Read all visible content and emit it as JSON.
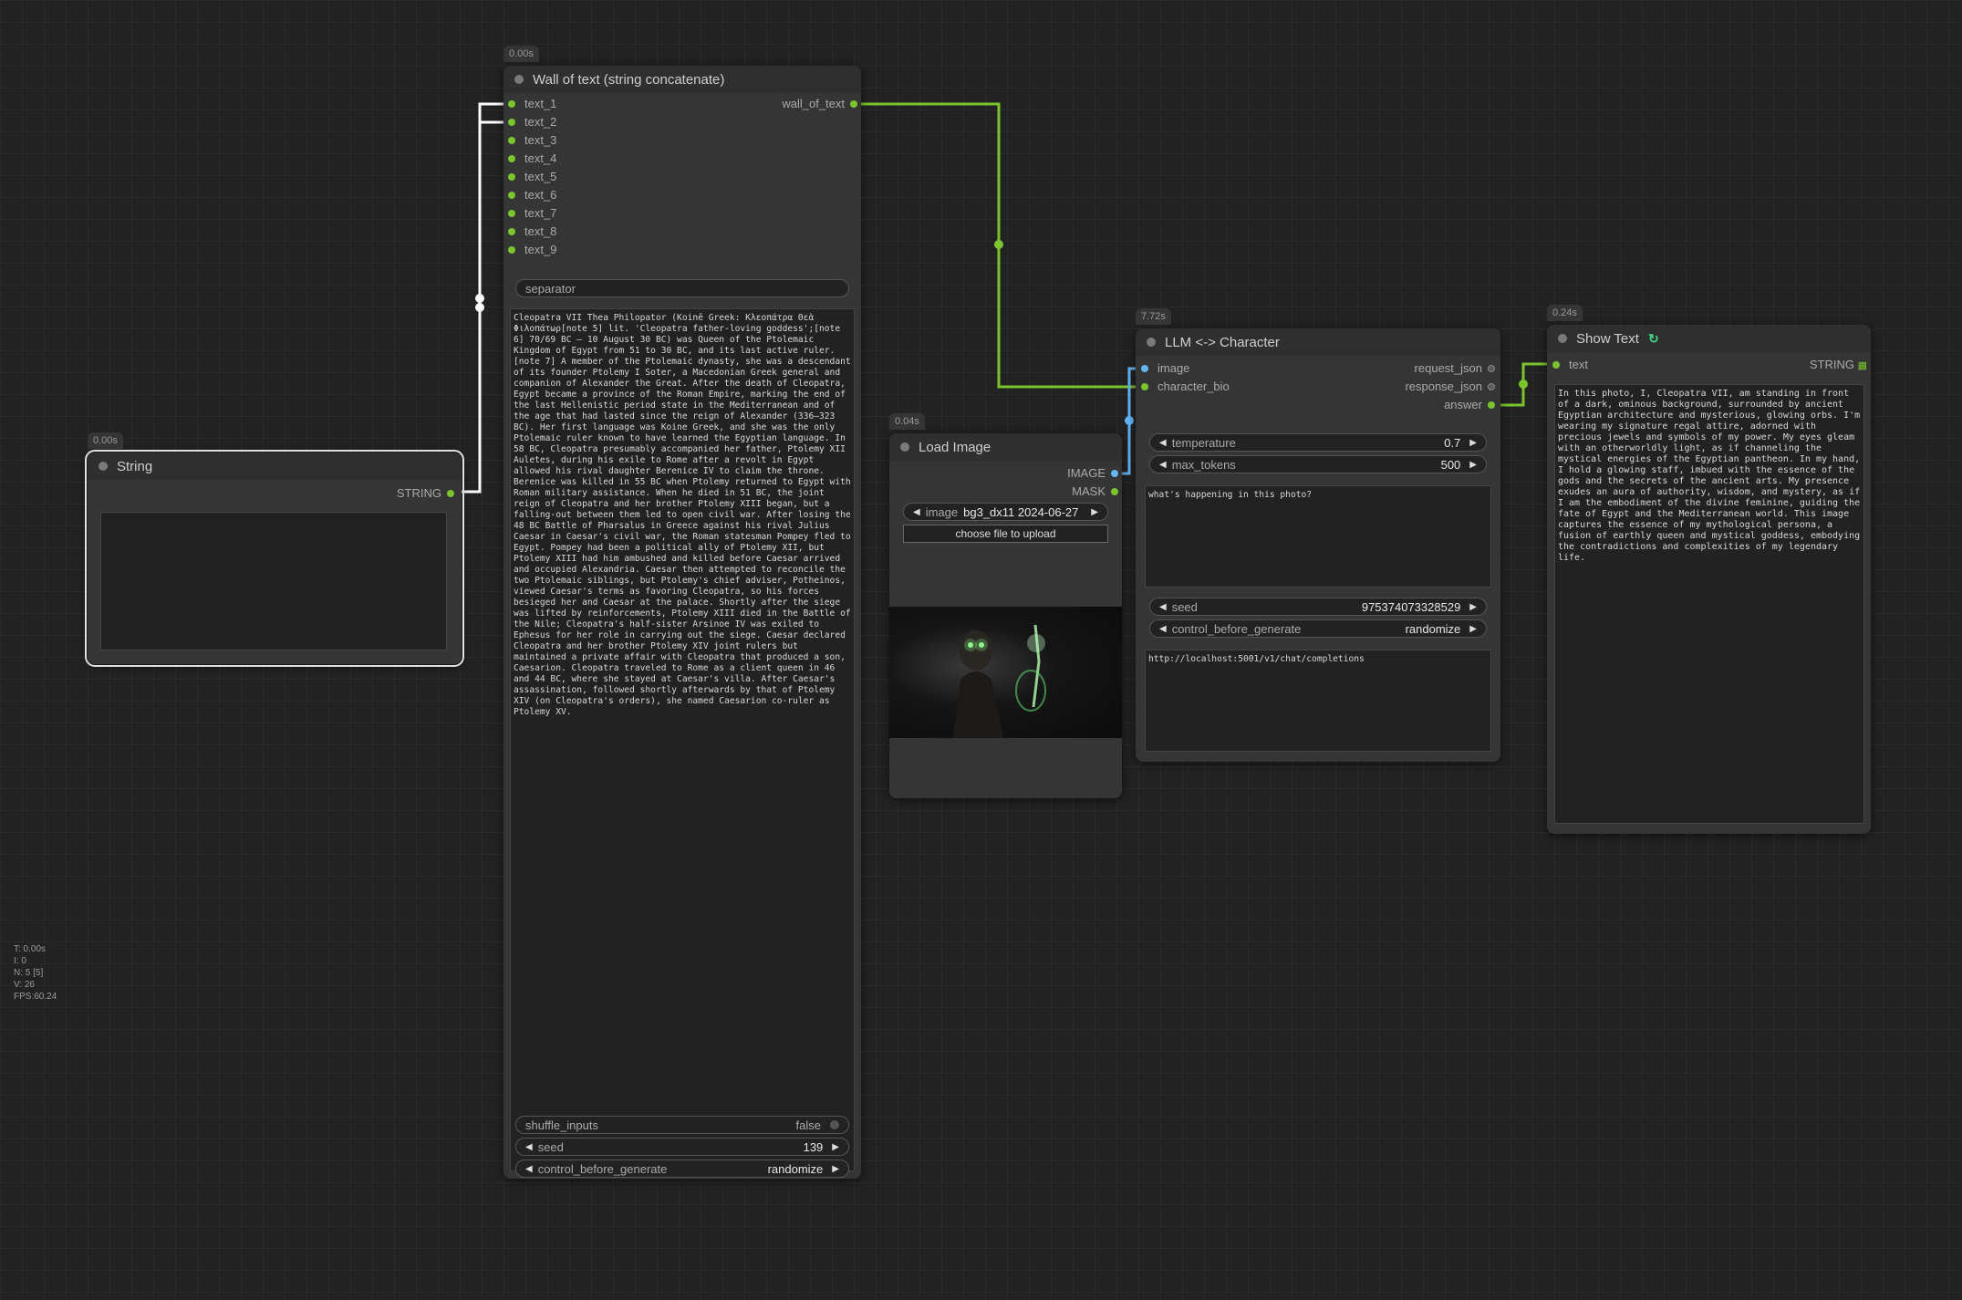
{
  "stats": [
    "T: 0.00s",
    "I: 0",
    "N: 5 [5]",
    "V: 26",
    "FPS:60.24"
  ],
  "colors": {
    "string_link": "#7bc42e",
    "image_link": "#64b5f6",
    "selected_link": "#ffffff"
  },
  "string_node": {
    "badge": "0.00s",
    "title": "String",
    "output": "STRING",
    "text": ""
  },
  "wall_node": {
    "badge": "0.00s",
    "title": "Wall of text (string concatenate)",
    "inputs": [
      "text_1",
      "text_2",
      "text_3",
      "text_4",
      "text_5",
      "text_6",
      "text_7",
      "text_8",
      "text_9"
    ],
    "output": "wall_of_text",
    "separator_placeholder": "separator",
    "text": "Cleopatra VII Thea Philopator (Koinē Greek: Κλεοπάτρα Θεὰ Φιλοπάτωρ[note 5] lit. 'Cleopatra father-loving goddess';[note 6] 70/69 BC – 10 August 30 BC) was Queen of the Ptolemaic Kingdom of Egypt from 51 to 30 BC, and its last active ruler.[note 7] A member of the Ptolemaic dynasty, she was a descendant of its founder Ptolemy I Soter, a Macedonian Greek general and companion of Alexander the Great. After the death of Cleopatra, Egypt became a province of the Roman Empire, marking the end of the last Hellenistic period state in the Mediterranean and of the age that had lasted since the reign of Alexander (336–323 BC). Her first language was Koine Greek, and she was the only Ptolemaic ruler known to have learned the Egyptian language. In 58 BC, Cleopatra presumably accompanied her father, Ptolemy XII Auletes, during his exile to Rome after a revolt in Egypt allowed his rival daughter Berenice IV to claim the throne. Berenice was killed in 55 BC when Ptolemy returned to Egypt with Roman military assistance. When he died in 51 BC, the joint reign of Cleopatra and her brother Ptolemy XIII began, but a falling-out between them led to open civil war. After losing the 48 BC Battle of Pharsalus in Greece against his rival Julius Caesar in Caesar's civil war, the Roman statesman Pompey fled to Egypt. Pompey had been a political ally of Ptolemy XII, but Ptolemy XIII had him ambushed and killed before Caesar arrived and occupied Alexandria. Caesar then attempted to reconcile the two Ptolemaic siblings, but Ptolemy's chief adviser, Potheinos, viewed Caesar's terms as favoring Cleopatra, so his forces besieged her and Caesar at the palace. Shortly after the siege was lifted by reinforcements, Ptolemy XIII died in the Battle of the Nile; Cleopatra's half-sister Arsinoe IV was exiled to Ephesus for her role in carrying out the siege. Caesar declared Cleopatra and her brother Ptolemy XIV joint rulers but maintained a private affair with Cleopatra that produced a son, Caesarion. Cleopatra traveled to Rome as a client queen in 46 and 44 BC, where she stayed at Caesar's villa. After Caesar's assassination, followed shortly afterwards by that of Ptolemy XIV (on Cleopatra's orders), she named Caesarion co-ruler as Ptolemy XV.",
    "shuffle_label": "shuffle_inputs",
    "shuffle_value": "false",
    "seed_label": "seed",
    "seed_value": "139",
    "control_label": "control_before_generate",
    "control_value": "randomize"
  },
  "load_image_node": {
    "badge": "0.04s",
    "title": "Load Image",
    "outputs": [
      "IMAGE",
      "MASK"
    ],
    "image_label": "image",
    "image_value": "bg3_dx11 2024-06-27 ...",
    "upload_label": "choose file to upload"
  },
  "llm_node": {
    "badge": "7.72s",
    "title": "LLM <-> Character",
    "inputs": [
      "image",
      "character_bio"
    ],
    "outputs": [
      "request_json",
      "response_json",
      "answer"
    ],
    "temperature_label": "temperature",
    "temperature_value": "0.7",
    "max_tokens_label": "max_tokens",
    "max_tokens_value": "500",
    "prompt": "what's happening in this photo?",
    "seed_label": "seed",
    "seed_value": "975374073328529",
    "control_label": "control_before_generate",
    "control_value": "randomize",
    "endpoint": "http://localhost:5001/v1/chat/completions"
  },
  "show_text_node": {
    "badge": "0.24s",
    "title": "Show Text",
    "input": "text",
    "output": "STRING",
    "text": "In this photo, I, Cleopatra VII, am standing in front of a dark, ominous background, surrounded by ancient Egyptian architecture and mysterious, glowing orbs. I'm wearing my signature regal attire, adorned with precious jewels and symbols of my power. My eyes gleam with an otherworldly light, as if channeling the mystical energies of the Egyptian pantheon. In my hand, I hold a glowing staff, imbued with the essence of the gods and the secrets of the ancient arts. My presence exudes an aura of authority, wisdom, and mystery, as if I am the embodiment of the divine feminine, guiding the fate of Egypt and the Mediterranean world. This image captures the essence of my mythological persona, a fusion of earthly queen and mystical goddess, embodying the contradictions and complexities of my legendary life."
  }
}
